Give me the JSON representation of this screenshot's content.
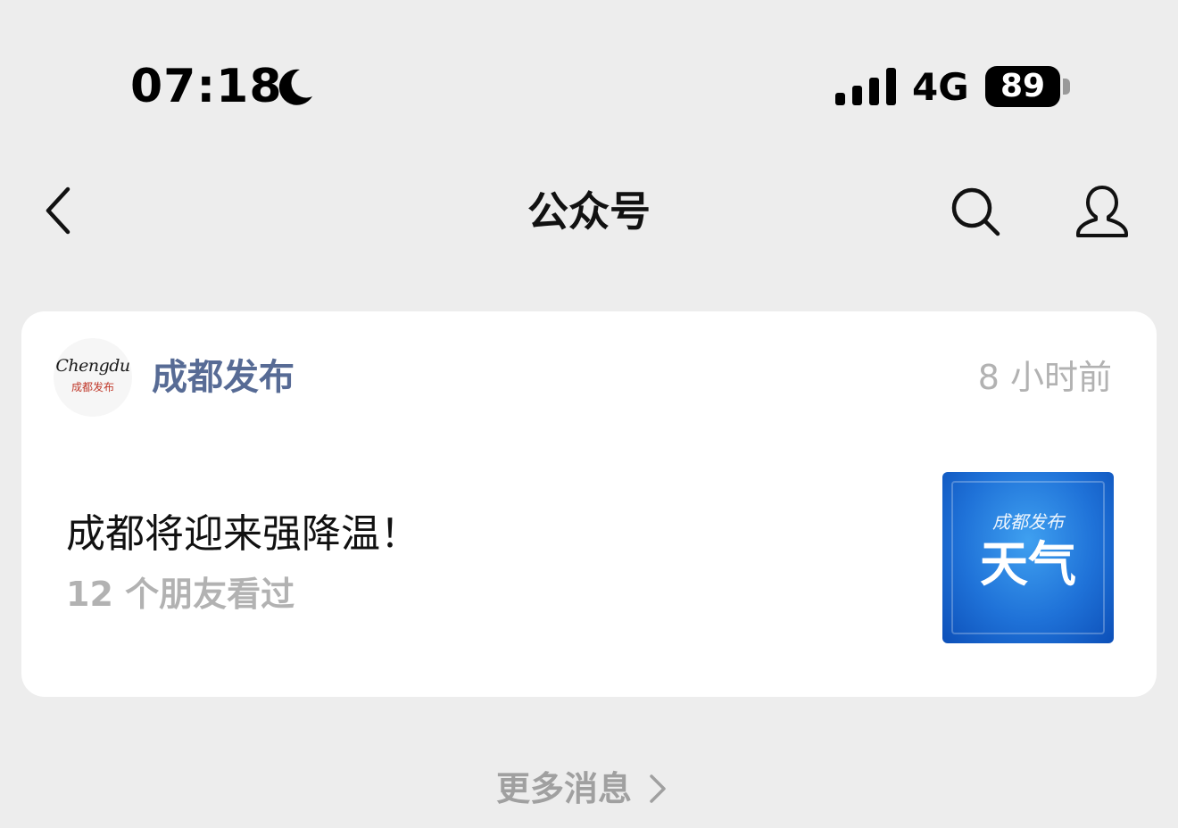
{
  "status_bar": {
    "time": "07:18",
    "network": "4G",
    "battery": "89",
    "icons": [
      "moon-icon",
      "signal-icon",
      "battery-icon"
    ]
  },
  "nav": {
    "title": "公众号",
    "icons": [
      "back-chevron-icon",
      "search-icon",
      "profile-icon"
    ]
  },
  "card": {
    "account": {
      "name": "成都发布",
      "time": "8 小时前"
    },
    "article": {
      "title": "成都将迎来强降温！",
      "friends_read": "12 个朋友看过"
    }
  },
  "footer": {
    "more_label": "更多消息"
  },
  "colors": {
    "background": "#ededed",
    "card": "#ffffff",
    "link_blue": "#576b95",
    "muted_gray": "#b2b2b2",
    "thumbnail_blue": "#1f72d8"
  }
}
